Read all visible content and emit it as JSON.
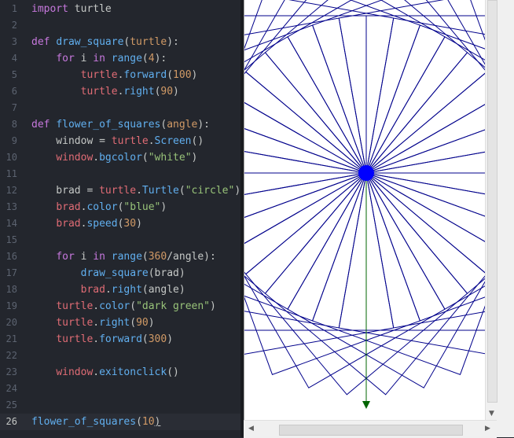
{
  "editor": {
    "active_line": 26,
    "lines": [
      {
        "n": "1",
        "tokens": [
          [
            "kw",
            "import"
          ],
          [
            "txt",
            " turtle"
          ]
        ]
      },
      {
        "n": "2",
        "tokens": []
      },
      {
        "n": "3",
        "tokens": [
          [
            "kw",
            "def "
          ],
          [
            "fn",
            "draw_square"
          ],
          [
            "txt",
            "("
          ],
          [
            "num",
            "turtle"
          ],
          [
            "txt",
            "):"
          ]
        ]
      },
      {
        "n": "4",
        "tokens": [
          [
            "txt",
            "    "
          ],
          [
            "kw",
            "for"
          ],
          [
            "txt",
            " i "
          ],
          [
            "kw",
            "in"
          ],
          [
            "txt",
            " "
          ],
          [
            "fn",
            "range"
          ],
          [
            "txt",
            "("
          ],
          [
            "num",
            "4"
          ],
          [
            "txt",
            "):"
          ]
        ]
      },
      {
        "n": "5",
        "tokens": [
          [
            "txt",
            "        "
          ],
          [
            "id",
            "turtle"
          ],
          [
            "txt",
            "."
          ],
          [
            "fn",
            "forward"
          ],
          [
            "txt",
            "("
          ],
          [
            "num",
            "100"
          ],
          [
            "txt",
            ")"
          ]
        ]
      },
      {
        "n": "6",
        "tokens": [
          [
            "txt",
            "        "
          ],
          [
            "id",
            "turtle"
          ],
          [
            "txt",
            "."
          ],
          [
            "fn",
            "right"
          ],
          [
            "txt",
            "("
          ],
          [
            "num",
            "90"
          ],
          [
            "txt",
            ")"
          ]
        ]
      },
      {
        "n": "7",
        "tokens": []
      },
      {
        "n": "8",
        "tokens": [
          [
            "kw",
            "def "
          ],
          [
            "fn",
            "flower_of_squares"
          ],
          [
            "txt",
            "("
          ],
          [
            "num",
            "angle"
          ],
          [
            "txt",
            "):"
          ]
        ]
      },
      {
        "n": "9",
        "tokens": [
          [
            "txt",
            "    window = "
          ],
          [
            "id",
            "turtle"
          ],
          [
            "txt",
            "."
          ],
          [
            "fn",
            "Screen"
          ],
          [
            "txt",
            "()"
          ]
        ]
      },
      {
        "n": "10",
        "tokens": [
          [
            "txt",
            "    "
          ],
          [
            "id",
            "window"
          ],
          [
            "txt",
            "."
          ],
          [
            "fn",
            "bgcolor"
          ],
          [
            "txt",
            "("
          ],
          [
            "str",
            "\"white\""
          ],
          [
            "txt",
            ")"
          ]
        ]
      },
      {
        "n": "11",
        "tokens": []
      },
      {
        "n": "12",
        "tokens": [
          [
            "txt",
            "    brad = "
          ],
          [
            "id",
            "turtle"
          ],
          [
            "txt",
            "."
          ],
          [
            "fn",
            "Turtle"
          ],
          [
            "txt",
            "("
          ],
          [
            "str",
            "\"circle\""
          ],
          [
            "txt",
            ")"
          ]
        ]
      },
      {
        "n": "13",
        "tokens": [
          [
            "txt",
            "    "
          ],
          [
            "id",
            "brad"
          ],
          [
            "txt",
            "."
          ],
          [
            "fn",
            "color"
          ],
          [
            "txt",
            "("
          ],
          [
            "str",
            "\"blue\""
          ],
          [
            "txt",
            ")"
          ]
        ]
      },
      {
        "n": "14",
        "tokens": [
          [
            "txt",
            "    "
          ],
          [
            "id",
            "brad"
          ],
          [
            "txt",
            "."
          ],
          [
            "fn",
            "speed"
          ],
          [
            "txt",
            "("
          ],
          [
            "num",
            "30"
          ],
          [
            "txt",
            ")"
          ]
        ]
      },
      {
        "n": "15",
        "tokens": []
      },
      {
        "n": "16",
        "tokens": [
          [
            "txt",
            "    "
          ],
          [
            "kw",
            "for"
          ],
          [
            "txt",
            " i "
          ],
          [
            "kw",
            "in"
          ],
          [
            "txt",
            " "
          ],
          [
            "fn",
            "range"
          ],
          [
            "txt",
            "("
          ],
          [
            "num",
            "360"
          ],
          [
            "txt",
            "/angle):"
          ]
        ]
      },
      {
        "n": "17",
        "tokens": [
          [
            "txt",
            "        "
          ],
          [
            "fn",
            "draw_square"
          ],
          [
            "txt",
            "(brad)"
          ]
        ]
      },
      {
        "n": "18",
        "tokens": [
          [
            "txt",
            "        "
          ],
          [
            "id",
            "brad"
          ],
          [
            "txt",
            "."
          ],
          [
            "fn",
            "right"
          ],
          [
            "txt",
            "(angle)"
          ]
        ]
      },
      {
        "n": "19",
        "tokens": [
          [
            "txt",
            "    "
          ],
          [
            "id",
            "turtle"
          ],
          [
            "txt",
            "."
          ],
          [
            "fn",
            "color"
          ],
          [
            "txt",
            "("
          ],
          [
            "str",
            "\"dark green\""
          ],
          [
            "txt",
            ")"
          ]
        ]
      },
      {
        "n": "20",
        "tokens": [
          [
            "txt",
            "    "
          ],
          [
            "id",
            "turtle"
          ],
          [
            "txt",
            "."
          ],
          [
            "fn",
            "right"
          ],
          [
            "txt",
            "("
          ],
          [
            "num",
            "90"
          ],
          [
            "txt",
            ")"
          ]
        ]
      },
      {
        "n": "21",
        "tokens": [
          [
            "txt",
            "    "
          ],
          [
            "id",
            "turtle"
          ],
          [
            "txt",
            "."
          ],
          [
            "fn",
            "forward"
          ],
          [
            "txt",
            "("
          ],
          [
            "num",
            "300"
          ],
          [
            "txt",
            ")"
          ]
        ]
      },
      {
        "n": "22",
        "tokens": []
      },
      {
        "n": "23",
        "tokens": [
          [
            "txt",
            "    "
          ],
          [
            "id",
            "window"
          ],
          [
            "txt",
            "."
          ],
          [
            "fn",
            "exitonclick"
          ],
          [
            "txt",
            "()"
          ]
        ]
      },
      {
        "n": "24",
        "tokens": []
      },
      {
        "n": "25",
        "tokens": []
      },
      {
        "n": "26",
        "tokens": [
          [
            "fn",
            "flower_of_squares"
          ],
          [
            "txt",
            "("
          ],
          [
            "num",
            "10"
          ],
          [
            "txt",
            ")"
          ]
        ]
      }
    ]
  },
  "turtle_drawing": {
    "flower_color": "#00008b",
    "turtle_fill": "#0000ff",
    "stem_color": "#006400",
    "background": "#ffffff",
    "square_side": 100,
    "turn_angle": 10,
    "square_count": 36,
    "stem_length": 300
  },
  "scrollbars": {
    "left_arrow": "◀",
    "right_arrow": "▶",
    "down_arrow": "▼"
  }
}
